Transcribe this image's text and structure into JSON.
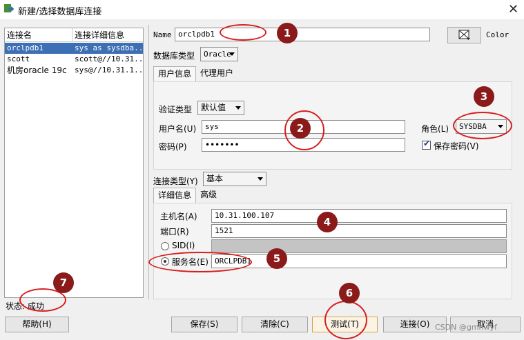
{
  "window": {
    "title": "新建/选择数据库连接",
    "close_glyph": "✕"
  },
  "connections": {
    "headers": [
      "连接名",
      "连接详细信息"
    ],
    "rows": [
      {
        "name": "orclpdb1",
        "detail": "sys as sysdba..."
      },
      {
        "name": "scott",
        "detail": "scott@//10.31...."
      },
      {
        "name": "机房oracle 19c",
        "detail": "sys@//10.31.1..."
      }
    ]
  },
  "form": {
    "name_label": "Name",
    "name_value": "orclpdb1",
    "color_label": "Color",
    "db_type_label": "数据库类型",
    "db_type_value": "Oracle",
    "tabs": [
      "用户信息",
      "代理用户"
    ],
    "auth_type_label": "验证类型",
    "auth_type_value": "默认值",
    "username_label": "用户名(U)",
    "username_value": "sys",
    "password_label": "密码(P)",
    "password_value": "•••••••",
    "role_label": "角色(L)",
    "role_value": "SYSDBA",
    "save_password_label": "保存密码(V)",
    "save_password_checked": true,
    "conn_type_label": "连接类型(Y)",
    "conn_type_value": "基本",
    "detail_tabs": [
      "详细信息",
      "高级"
    ],
    "host_label": "主机名(A)",
    "host_value": "10.31.100.107",
    "port_label": "端口(R)",
    "port_value": "1521",
    "sid_label": "SID(I)",
    "service_label": "服务名(E)",
    "service_value": "ORCLPDB1"
  },
  "status": {
    "text": "状态: 成功"
  },
  "buttons": {
    "help": "帮助(H)",
    "save": "保存(S)",
    "clear": "清除(C)",
    "test": "测试(T)",
    "connect": "连接(O)",
    "cancel": "取消"
  },
  "annotations": [
    "1",
    "2",
    "3",
    "4",
    "5",
    "6",
    "7"
  ],
  "watermark": "CSDN @gmnwyf",
  "colors": {
    "badge": "#8b1a1a",
    "ring": "#d81e1e",
    "selection": "#3c6fb4"
  }
}
